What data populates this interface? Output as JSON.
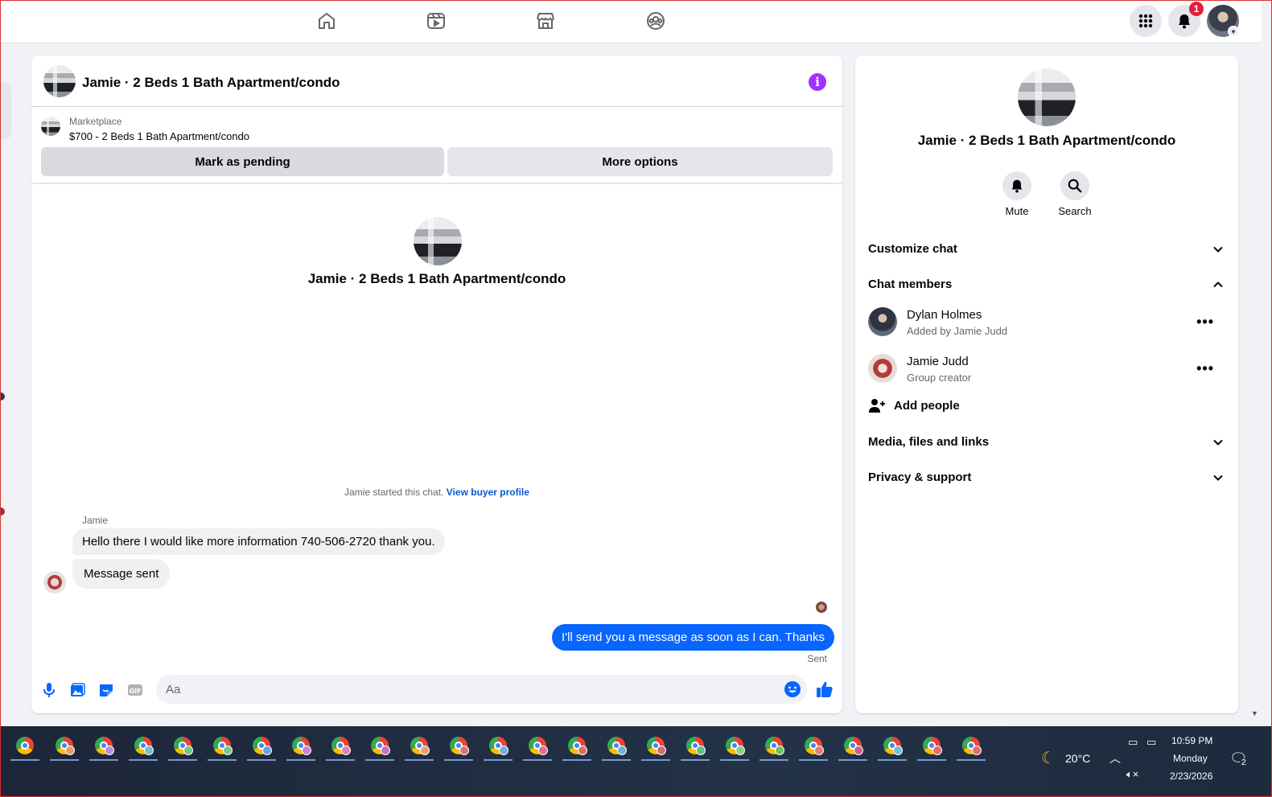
{
  "nav": {
    "icons": [
      "home-icon",
      "video-icon",
      "marketplace-icon",
      "groups-icon"
    ],
    "notifications_badge": "1"
  },
  "chat": {
    "title": "Jamie · 2 Beds 1 Bath Apartment/condo",
    "marketplace": {
      "label": "Marketplace",
      "listing": "$700 - 2 Beds 1 Bath Apartment/condo"
    },
    "buttons": {
      "mark_pending": "Mark as pending",
      "more_options": "More options"
    },
    "intro_title": "Jamie · 2 Beds 1 Bath Apartment/condo",
    "started_text": "Jamie started this chat.",
    "view_buyer_profile": "View buyer profile",
    "sender_name": "Jamie",
    "messages_in": [
      "Hello there I would like more information  740-506-2720 thank you.",
      "Message sent"
    ],
    "message_out": "I'll send you a message as soon as I can. Thanks",
    "sent_status": "Sent",
    "composer": {
      "placeholder": "Aa"
    },
    "accent_color": "#0866ff"
  },
  "info_panel": {
    "title": "Jamie · 2 Beds 1 Bath Apartment/condo",
    "actions": {
      "mute": "Mute",
      "search": "Search"
    },
    "sections": {
      "customize_chat": "Customize chat",
      "chat_members": "Chat members",
      "media": "Media, files and links",
      "privacy": "Privacy & support"
    },
    "members": [
      {
        "name": "Dylan Holmes",
        "sub": "Added by Jamie Judd"
      },
      {
        "name": "Jamie Judd",
        "sub": "Group creator"
      }
    ],
    "add_people": "Add people"
  },
  "taskbar": {
    "weather": "20°C",
    "time": "10:59 PM",
    "day": "Monday",
    "date": "2/23/2026",
    "notification_count": "2"
  }
}
